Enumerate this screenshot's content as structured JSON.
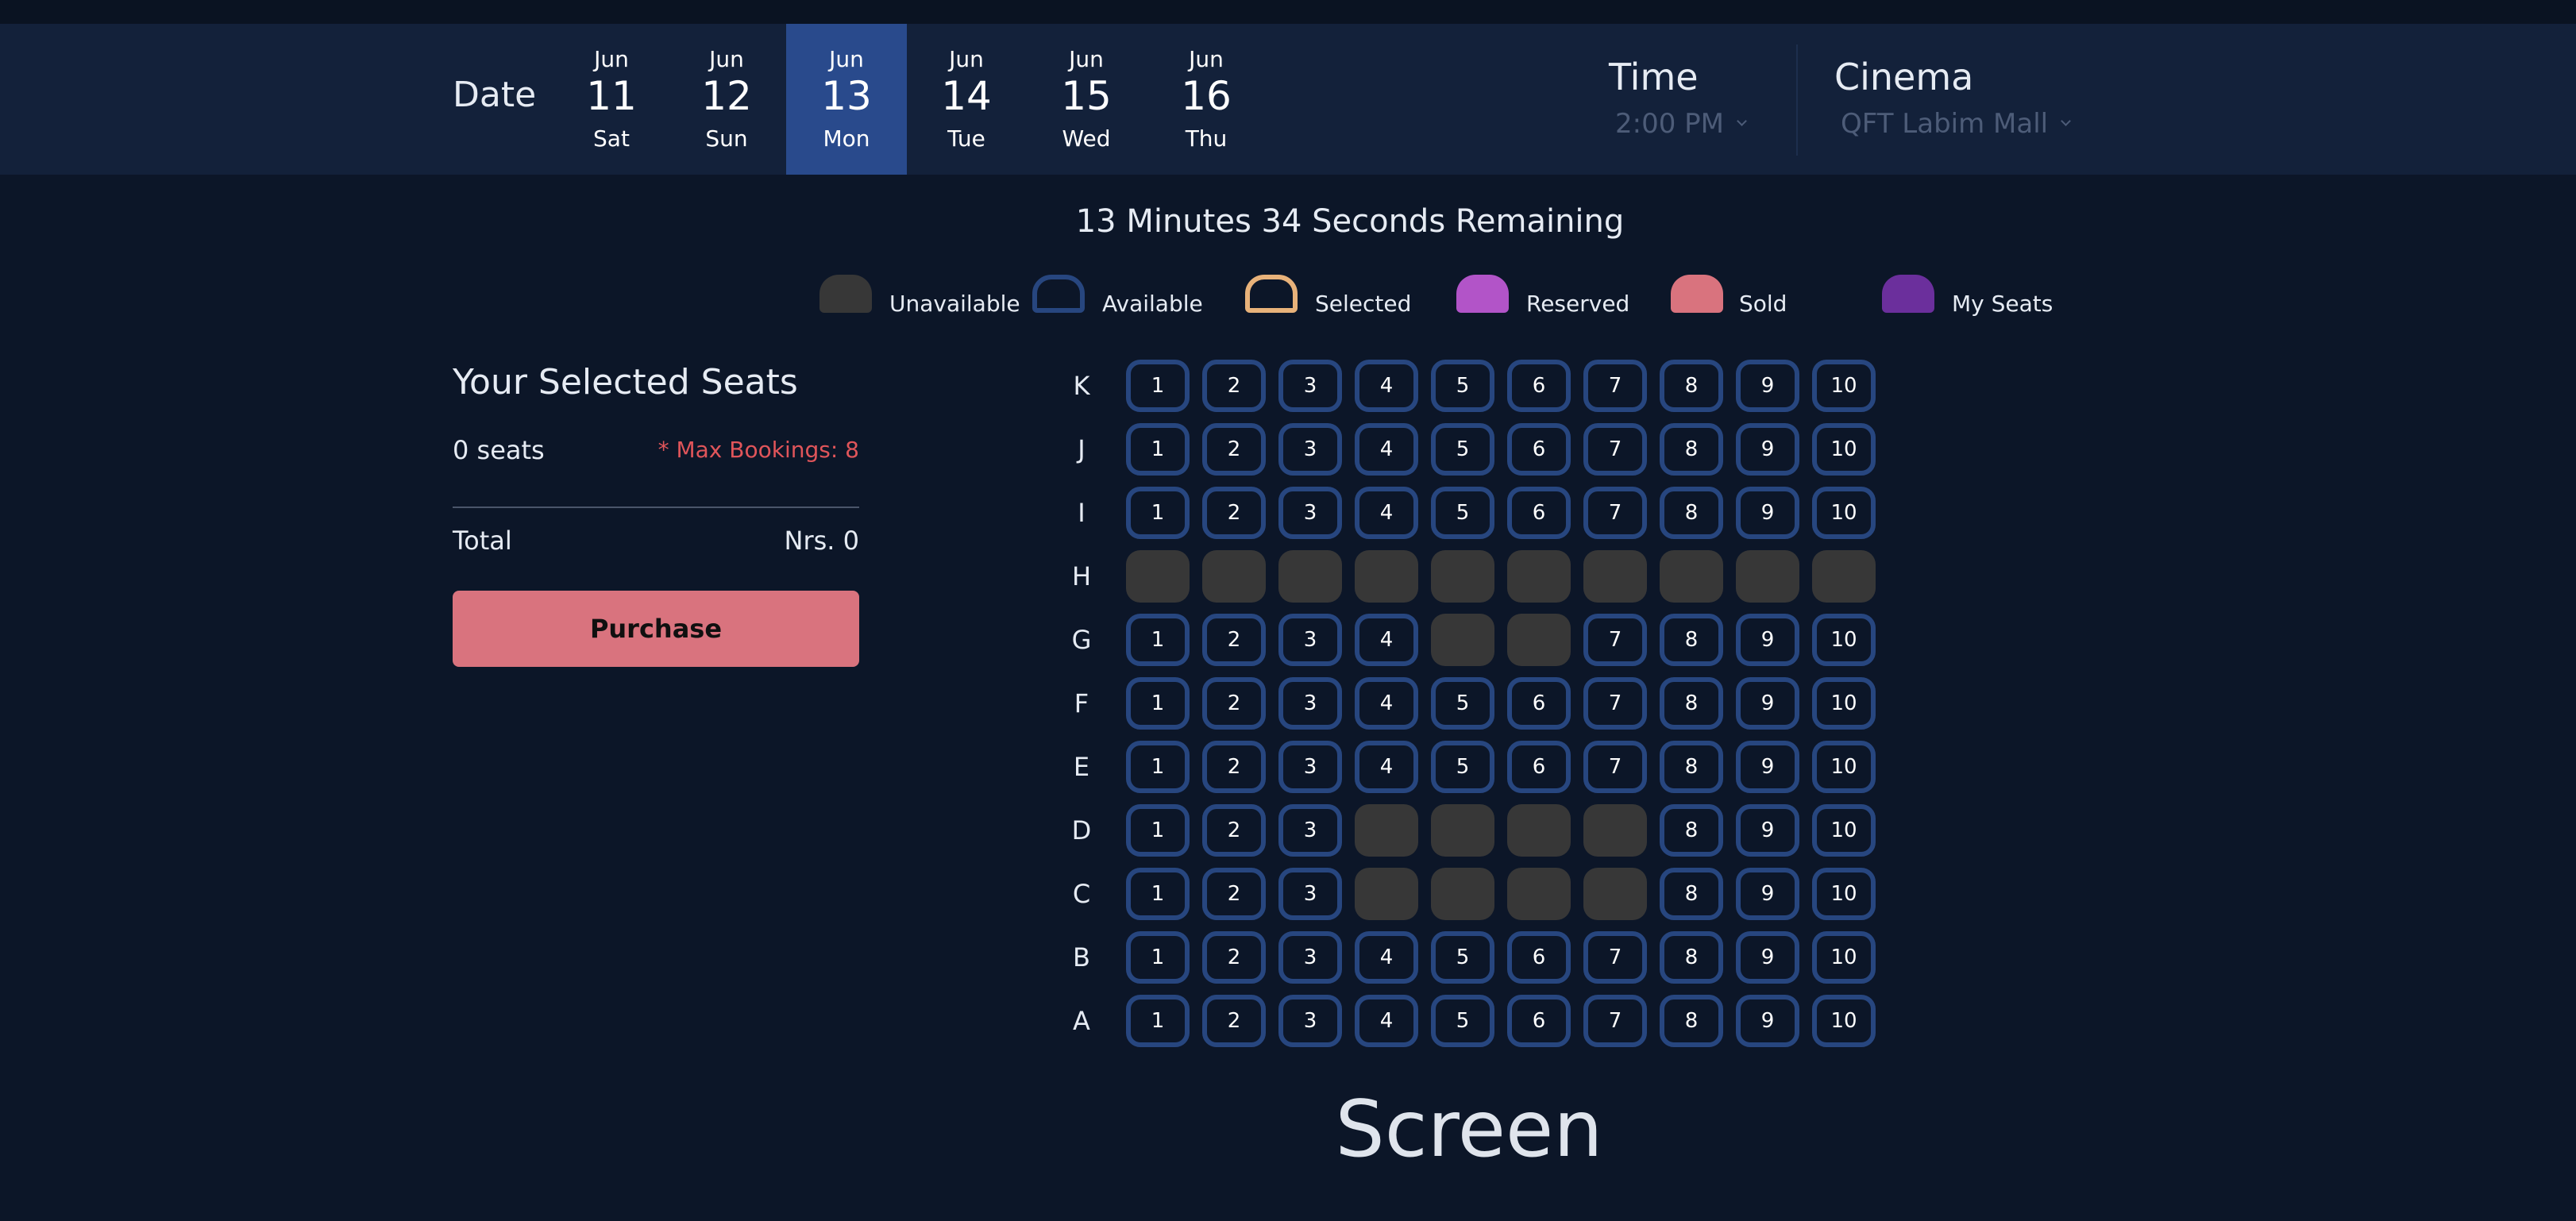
{
  "header": {
    "date_label": "Date",
    "dates": [
      {
        "month": "Jun",
        "day": "11",
        "weekday": "Sat",
        "active": false
      },
      {
        "month": "Jun",
        "day": "12",
        "weekday": "Sun",
        "active": false
      },
      {
        "month": "Jun",
        "day": "13",
        "weekday": "Mon",
        "active": true
      },
      {
        "month": "Jun",
        "day": "14",
        "weekday": "Tue",
        "active": false
      },
      {
        "month": "Jun",
        "day": "15",
        "weekday": "Wed",
        "active": false
      },
      {
        "month": "Jun",
        "day": "16",
        "weekday": "Thu",
        "active": false
      }
    ],
    "time": {
      "title": "Time",
      "value": "2:00 PM"
    },
    "cinema": {
      "title": "Cinema",
      "value": "QFT Labim Mall"
    }
  },
  "timer": "13 Minutes 34 Seconds Remaining",
  "legend": [
    {
      "key": "unavailable",
      "label": "Unavailable",
      "color": "#373737",
      "outline": false
    },
    {
      "key": "available",
      "label": "Available",
      "color": "#27467f",
      "outline": true
    },
    {
      "key": "selected",
      "label": "Selected",
      "color": "#e8b27a",
      "outline": true
    },
    {
      "key": "reserved",
      "label": "Reserved",
      "color": "#b254c8",
      "outline": false
    },
    {
      "key": "sold",
      "label": "Sold",
      "color": "#d9737e",
      "outline": false
    },
    {
      "key": "my-seats",
      "label": "My Seats",
      "color": "#6b2f9c",
      "outline": false
    }
  ],
  "selection": {
    "title": "Your Selected Seats",
    "count_text": "0 seats",
    "max_text": "* Max Bookings: 8",
    "total_label": "Total",
    "total_value": "Nrs. 0",
    "purchase_label": "Purchase"
  },
  "seatmap": {
    "seats_per_row": 10,
    "rows": [
      {
        "label": "K",
        "unavailable": []
      },
      {
        "label": "J",
        "unavailable": []
      },
      {
        "label": "I",
        "unavailable": []
      },
      {
        "label": "H",
        "unavailable": [
          1,
          2,
          3,
          4,
          5,
          6,
          7,
          8,
          9,
          10
        ]
      },
      {
        "label": "G",
        "unavailable": [
          5,
          6
        ]
      },
      {
        "label": "F",
        "unavailable": []
      },
      {
        "label": "E",
        "unavailable": []
      },
      {
        "label": "D",
        "unavailable": [
          4,
          5,
          6,
          7
        ]
      },
      {
        "label": "C",
        "unavailable": [
          4,
          5,
          6,
          7
        ]
      },
      {
        "label": "B",
        "unavailable": []
      },
      {
        "label": "A",
        "unavailable": []
      }
    ],
    "screen_label": "Screen"
  },
  "colors": {
    "background": "#0c1628",
    "header": "#13213a",
    "active_date": "#294a8c",
    "seat_outline": "#27467f",
    "seat_unavailable": "#373737",
    "purchase": "#d9737e",
    "max_warning": "#e0555a"
  }
}
